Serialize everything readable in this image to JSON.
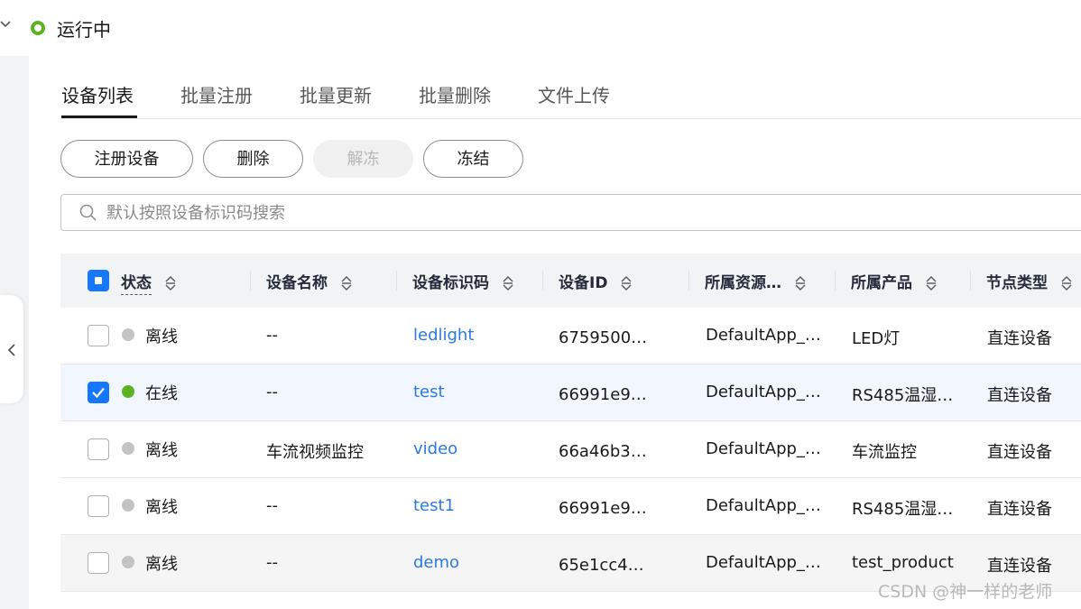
{
  "header": {
    "status_label": "运行中",
    "status_color": "#5cb322"
  },
  "tabs": [
    {
      "label": "设备列表",
      "active": true
    },
    {
      "label": "批量注册",
      "active": false
    },
    {
      "label": "批量更新",
      "active": false
    },
    {
      "label": "批量删除",
      "active": false
    },
    {
      "label": "文件上传",
      "active": false
    }
  ],
  "toolbar": {
    "register_label": "注册设备",
    "delete_label": "删除",
    "unfreeze_label": "解冻",
    "freeze_label": "冻结"
  },
  "search": {
    "placeholder": "默认按照设备标识码搜索",
    "value": ""
  },
  "table": {
    "columns": [
      "状态",
      "设备名称",
      "设备标识码",
      "设备ID",
      "所属资源…",
      "所属产品",
      "节点类型"
    ],
    "rows": [
      {
        "selected": false,
        "online": false,
        "status": "离线",
        "name": "--",
        "identifier": "ledlight",
        "device_id": "6759500…",
        "resource": "DefaultApp_…",
        "product": "LED灯",
        "node_type": "直连设备"
      },
      {
        "selected": true,
        "online": true,
        "status": "在线",
        "name": "--",
        "identifier": "test",
        "device_id": "66991e9…",
        "resource": "DefaultApp_…",
        "product": "RS485温湿…",
        "node_type": "直连设备"
      },
      {
        "selected": false,
        "online": false,
        "status": "离线",
        "name": "车流视频监控",
        "identifier": "video",
        "device_id": "66a46b3…",
        "resource": "DefaultApp_…",
        "product": "车流监控",
        "node_type": "直连设备"
      },
      {
        "selected": false,
        "online": false,
        "status": "离线",
        "name": "--",
        "identifier": "test1",
        "device_id": "66991e9…",
        "resource": "DefaultApp_…",
        "product": "RS485温湿…",
        "node_type": "直连设备"
      },
      {
        "selected": false,
        "online": false,
        "status": "离线",
        "name": "--",
        "identifier": "demo",
        "device_id": "65e1cc4…",
        "resource": "DefaultApp_…",
        "product": "test_product",
        "node_type": "直连设备"
      }
    ]
  },
  "colors": {
    "link": "#2a7ae2",
    "checkbox_active": "#1677ff",
    "online": "#5cb322",
    "offline": "#c4c4c4"
  },
  "watermark": "CSDN @神一样的老师"
}
